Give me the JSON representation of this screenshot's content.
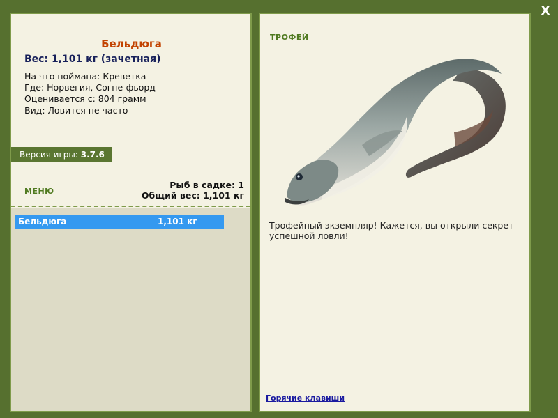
{
  "window": {
    "close_label": "X"
  },
  "fish": {
    "name": "Бельдюга",
    "weight_line": "Вес: 1,101 кг (зачетная)",
    "bait_line": "На что поймана: Креветка",
    "where_line": "Где: Норвегия, Согне-фьорд",
    "price_line": "Оценивается с: 804 грамм",
    "kind_line": "Вид: Ловится не часто"
  },
  "version": {
    "label": "Версия игры: ",
    "number": "3.7.6"
  },
  "menu": {
    "label": "МЕНЮ"
  },
  "keepnet": {
    "count_line": "Рыб в садке: 1",
    "total_line": "Общий вес: 1,101 кг",
    "items": [
      {
        "name": "Бельдюга",
        "weight": "1,101 кг"
      }
    ]
  },
  "trophy": {
    "label": "ТРОФЕЙ",
    "image_icon": "eelpout-fish-image",
    "description": "Трофейный экземпляр! Кажется, вы открыли секрет успешной ловли!"
  },
  "footer": {
    "hotkeys_label": "Горячие клавиши"
  },
  "colors": {
    "frame": "#56702f",
    "panel": "#f4f2e3",
    "fish_name": "#c24200",
    "weight": "#17205a",
    "menu": "#4f7a20",
    "selection": "#3499f0",
    "list_bg": "#dddbc6"
  }
}
